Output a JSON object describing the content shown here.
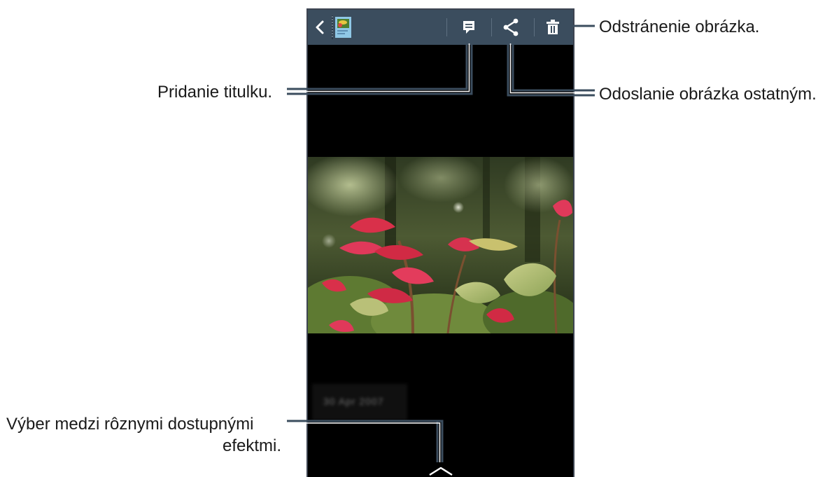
{
  "callouts": {
    "delete": "Odstránenie obrázka.",
    "caption": "Pridanie titulku.",
    "share": "Odoslanie obrázka ostatným.",
    "effects_line1": "Výber medzi rôznymi dostupnými",
    "effects_line2": "efektmi."
  },
  "photo_info": {
    "date_text": "30 Apr 2007"
  },
  "icons": {
    "back": "chevron-left-icon",
    "thumbnail": "album-thumbnail-icon",
    "caption": "caption-icon",
    "share": "share-icon",
    "delete": "trash-icon",
    "effects": "chevron-up-icon"
  },
  "colors": {
    "action_bar": "#3b4d5e",
    "callout_line": "#3b4d5e",
    "screen_background": "#000000"
  }
}
